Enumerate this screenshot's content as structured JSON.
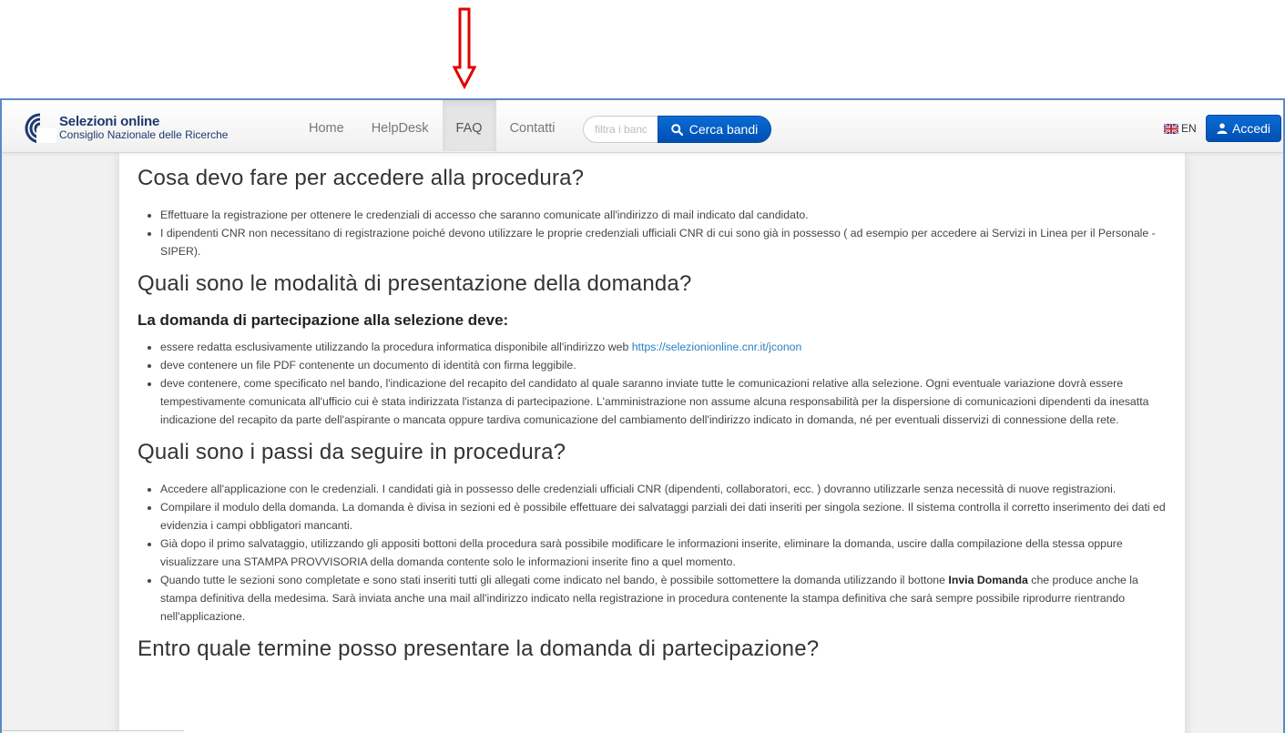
{
  "navbar": {
    "brand_title": "Selezioni online",
    "brand_subtitle": "Consiglio Nazionale delle Ricerche",
    "nav_items": [
      "Home",
      "HelpDesk",
      "FAQ",
      "Contatti"
    ],
    "active_nav": "FAQ",
    "search_placeholder": "filtra i bandi",
    "search_button": "Cerca bandi",
    "lang_label": "EN",
    "login_button": "Accedi"
  },
  "content": {
    "q1": {
      "title": "Cosa devo fare per accedere alla procedura?",
      "items": [
        "Effettuare la registrazione per ottenere le credenziali di accesso che saranno comunicate all'indirizzo di mail indicato dal candidato.",
        "I dipendenti CNR non necessitano di registrazione poiché devono utilizzare le proprie credenziali ufficiali CNR di cui sono già in possesso ( ad esempio per accedere ai Servizi in Linea per il Personale - SIPER)."
      ]
    },
    "q2": {
      "title": "Quali sono le modalità di presentazione della domanda?",
      "subtitle": "La domanda di partecipazione alla selezione deve:",
      "item1_text": "essere redatta esclusivamente utilizzando la procedura informatica disponibile all'indirizzo web ",
      "item1_link": "https://selezionionline.cnr.it/jconon",
      "item2": "deve contenere un file PDF contenente un documento di identità con firma leggibile.",
      "item3": "deve contenere, come specificato nel bando, l'indicazione del recapito del candidato al quale saranno inviate tutte le comunicazioni relative alla selezione. Ogni eventuale variazione dovrà essere tempestivamente comunicata all'ufficio cui è stata indirizzata l'istanza di partecipazione. L'amministrazione non assume alcuna responsabilità per la dispersione di comunicazioni dipendenti da inesatta indicazione del recapito da parte dell'aspirante o mancata oppure tardiva comunicazione del cambiamento dell'indirizzo indicato in domanda, né per eventuali disservizi di connessione della rete."
    },
    "q3": {
      "title": "Quali sono i passi da seguire in procedura?",
      "item1": "Accedere all'applicazione con le credenziali. I candidati già in possesso delle credenziali ufficiali CNR (dipendenti, collaboratori, ecc. ) dovranno utilizzarle senza necessità di nuove registrazioni.",
      "item2": "Compilare il modulo della domanda. La domanda è divisa in sezioni ed è possibile effettuare dei salvataggi parziali dei dati inseriti per singola sezione. Il sistema controlla il corretto inserimento dei dati ed evidenzia i campi obbligatori mancanti.",
      "item3": "Già dopo il primo salvataggio, utilizzando gli appositi bottoni della procedura sarà possibile modificare le informazioni inserite, eliminare la domanda, uscire dalla compilazione della stessa oppure visualizzare una STAMPA PROVVISORIA della domanda contente solo le informazioni inserite fino a quel momento.",
      "item4_before": "Quando tutte le sezioni sono completate e sono stati inseriti tutti gli allegati come indicato nel bando, è possibile sottomettere la domanda utilizzando il bottone ",
      "item4_bold": "Invia Domanda",
      "item4_after": " che produce anche la stampa definitiva della medesima. Sarà inviata anche una mail all'indirizzo indicato nella registrazione in procedura contenente la stampa definitiva che sarà sempre possibile riprodurre rientrando nell'applicazione."
    },
    "q4": {
      "title": "Entro quale termine posso presentare la domanda di partecipazione?"
    }
  },
  "colors": {
    "annotation_arrow": "#e00000",
    "primary_button": "#0a5fc4",
    "link": "#2a7fc1",
    "frame_border": "#5b8ac5"
  },
  "icons": [
    "annotation-arrow-icon",
    "cnr-logo-icon",
    "search-icon",
    "uk-flag-icon",
    "user-icon"
  ]
}
